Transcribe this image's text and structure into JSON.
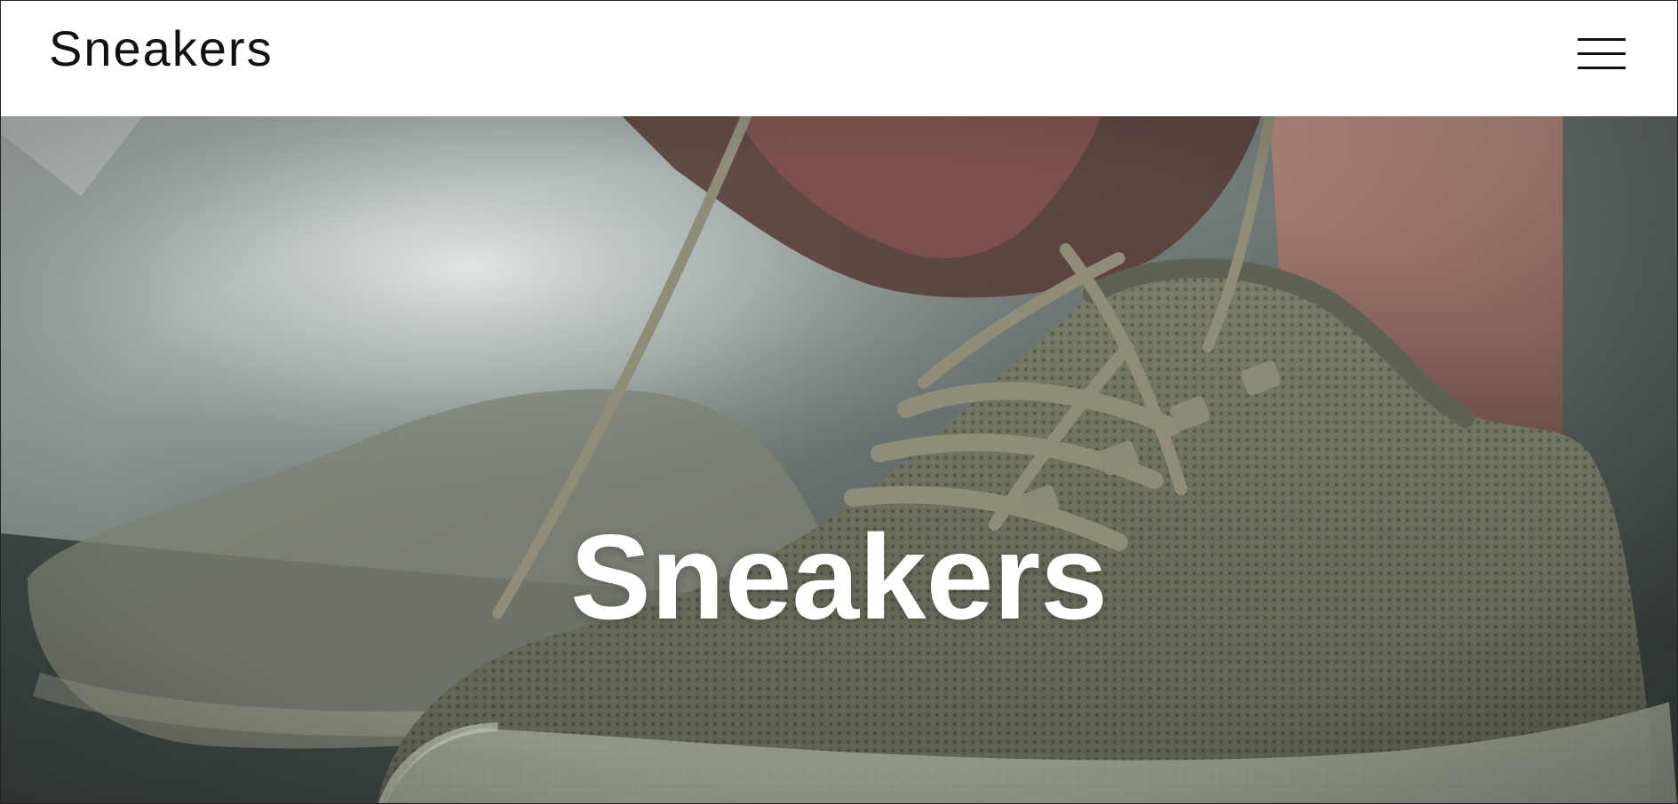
{
  "header": {
    "brand": "Sneakers",
    "menu_icon": "hamburger-menu-icon"
  },
  "hero": {
    "title": "Sneakers",
    "image": "sneaker-lacing-photo"
  },
  "colors": {
    "header_bg": "#ffffff",
    "brand_text": "#111111",
    "hero_text": "#ffffff",
    "sneaker_knit": "#7c7f6d",
    "hero_shadow": "#2f3734"
  }
}
